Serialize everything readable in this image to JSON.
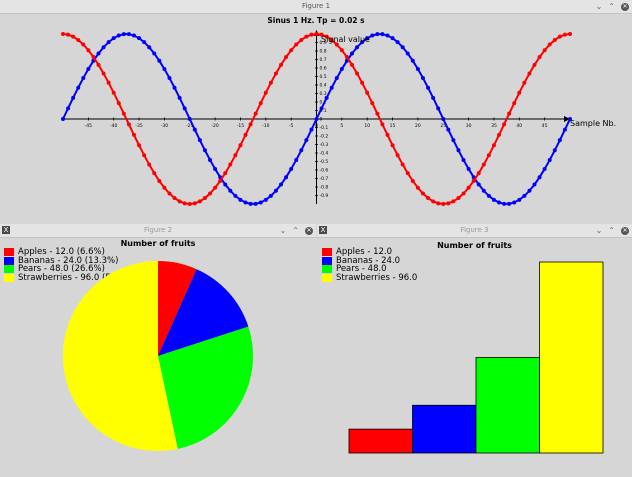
{
  "windows": {
    "fig1": {
      "title": "Figure 1"
    },
    "fig2": {
      "title": "Figure 2"
    },
    "fig3": {
      "title": "Figure 3"
    }
  },
  "icons": {
    "app": "x-window-icon",
    "minimize": "chevron-down-icon",
    "maximize": "chevron-up-icon",
    "close": "close-icon"
  },
  "chart_data": [
    {
      "type": "line",
      "title": "Sinus 1 Hz. Tp = 0.02 s",
      "xlabel": "Sample Nb.",
      "ylabel": "Signal value",
      "xlim": [
        -50,
        50
      ],
      "ylim": [
        -1,
        1
      ],
      "x_ticks": [
        -45,
        -40,
        -35,
        -30,
        -25,
        -20,
        -15,
        -10,
        -5,
        0,
        5,
        10,
        15,
        20,
        25,
        30,
        35,
        40,
        45
      ],
      "x_tick_labels": [
        "-45",
        "-40",
        "-35",
        "-30",
        "-25",
        "-20",
        "-15",
        "-10",
        "-5",
        "0",
        "5",
        "10",
        "15",
        "20",
        "25",
        "30",
        "35",
        "40",
        "45"
      ],
      "y_ticks": [
        0.9,
        0.8,
        0.7,
        0.6,
        0.5,
        0.4,
        0.3,
        0.2,
        0.1,
        0,
        -0.1,
        -0.2,
        -0.3,
        -0.4,
        -0.5,
        -0.6,
        -0.7,
        -0.8,
        -0.9
      ],
      "y_tick_labels": [
        "0.9",
        "0.8",
        "0.7",
        "0.6",
        "0.5",
        "0.4",
        "0.3",
        "0.2",
        "0.1",
        "0",
        "-0.1",
        "-0.2",
        "-0.3",
        "-0.4",
        "-0.5",
        "-0.6",
        "-0.7",
        "-0.8",
        "-0.9"
      ],
      "series": [
        {
          "function": "sin",
          "color": "#0000ff",
          "x_start": -50,
          "x_end": 50,
          "step": 1,
          "amplitude": 1,
          "frequency_hz": 1,
          "sample_period_s": 0.02
        },
        {
          "function": "cos",
          "color": "#ff0000",
          "x_start": -50,
          "x_end": 50,
          "step": 1,
          "amplitude": 1,
          "frequency_hz": 1,
          "sample_period_s": 0.02
        }
      ]
    },
    {
      "type": "pie",
      "title": "Number of fruits",
      "categories": [
        "Apples",
        "Bananas",
        "Pears",
        "Strawberries"
      ],
      "values": [
        12.0,
        24.0,
        48.0,
        96.0
      ],
      "colors": [
        "#ff0000",
        "#0000ff",
        "#00ff00",
        "#ffff00"
      ],
      "legend_labels": [
        "Apples - 12.0 (6.6%)",
        "Bananas - 24.0 (13.3%)",
        "Pears - 48.0 (26.6%)",
        "Strawberries - 96.0 (53.3%)"
      ],
      "legend_position": "top-left"
    },
    {
      "type": "bar",
      "title": "Number of fruits",
      "categories": [
        "Apples",
        "Bananas",
        "Pears",
        "Strawberries"
      ],
      "values": [
        12.0,
        24.0,
        48.0,
        96.0
      ],
      "colors": [
        "#ff0000",
        "#0000ff",
        "#00ff00",
        "#ffff00"
      ],
      "legend_labels": [
        "Apples - 12.0",
        "Bananas - 24.0",
        "Pears - 48.0",
        "Strawberries - 96.0"
      ],
      "legend_position": "top-left",
      "ylim": [
        0,
        96
      ]
    }
  ]
}
